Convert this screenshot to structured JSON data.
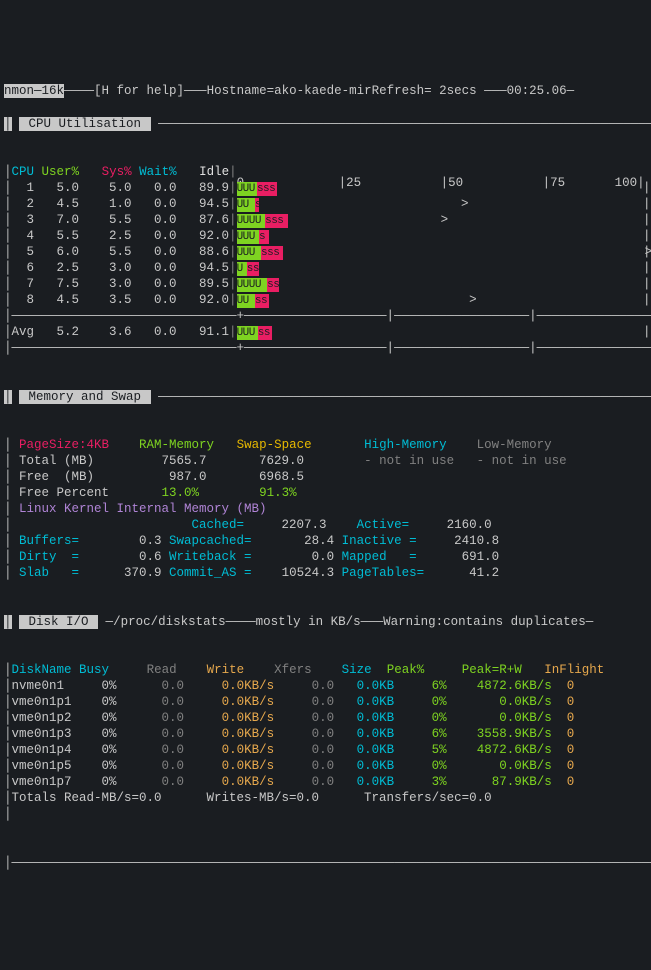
{
  "header": {
    "app": "nmon—16k",
    "help": "[H for help]",
    "hostname_label": "Hostname=",
    "hostname": "ako-kaede-mir",
    "refresh_label": "Refresh= ",
    "refresh": "2secs",
    "time": "00:25.06"
  },
  "cpu_section": {
    "title": " CPU Utilisation ",
    "headers": {
      "cpu": "CPU",
      "user": "User%",
      "sys": "Sys%",
      "wait": "Wait%",
      "idle": "Idle"
    },
    "ticks": [
      "0",
      "25",
      "50",
      "75",
      "100"
    ],
    "rows": [
      {
        "cpu": "1",
        "user": "5.0",
        "sys": "5.0",
        "wait": "0.0",
        "idle": "89.9",
        "u": 5,
        "s": 5,
        "caret": null
      },
      {
        "cpu": "2",
        "user": "4.5",
        "sys": "1.0",
        "wait": "0.0",
        "idle": "94.5",
        "u": 4.5,
        "s": 1,
        "caret": 55
      },
      {
        "cpu": "3",
        "user": "7.0",
        "sys": "5.5",
        "wait": "0.0",
        "idle": "87.6",
        "u": 7,
        "s": 5.5,
        "caret": 50
      },
      {
        "cpu": "4",
        "user": "5.5",
        "sys": "2.5",
        "wait": "0.0",
        "idle": "92.0",
        "u": 5.5,
        "s": 2.5,
        "caret": null
      },
      {
        "cpu": "5",
        "user": "6.0",
        "sys": "5.5",
        "wait": "0.0",
        "idle": "88.6",
        "u": 6,
        "s": 5.5,
        "caret": 100
      },
      {
        "cpu": "6",
        "user": "2.5",
        "sys": "3.0",
        "wait": "0.0",
        "idle": "94.5",
        "u": 2.5,
        "s": 3,
        "caret": null
      },
      {
        "cpu": "7",
        "user": "7.5",
        "sys": "3.0",
        "wait": "0.0",
        "idle": "89.5",
        "u": 7.5,
        "s": 3,
        "caret": null
      },
      {
        "cpu": "8",
        "user": "4.5",
        "sys": "3.5",
        "wait": "0.0",
        "idle": "92.0",
        "u": 4.5,
        "s": 3.5,
        "caret": 57
      }
    ],
    "avg": {
      "label": "Avg",
      "user": "5.2",
      "sys": "3.6",
      "wait": "0.0",
      "idle": "91.1",
      "u": 5.2,
      "s": 3.6
    }
  },
  "mem_section": {
    "title": " Memory and Swap ",
    "pagesize": "PageSize:4KB",
    "col_ram": "RAM-Memory",
    "col_swap": "Swap-Space",
    "col_high": "High-Memory",
    "col_low": "Low-Memory",
    "total_label": "Total (MB)",
    "total_ram": "7565.7",
    "total_swap": "7629.0",
    "not_in_use": "- not in use",
    "free_label": "Free  (MB)",
    "free_ram": "987.0",
    "free_swap": "6968.5",
    "freep_label": "Free Percent",
    "freep_ram": "13.0%",
    "freep_swap": "91.3%",
    "kernel_label": "Linux Kernel Internal Memory (MB)",
    "cached_l": "Cached=",
    "cached_v": "2207.3",
    "active_l": "Active=",
    "active_v": "2160.0",
    "buffers_l": "Buffers=",
    "buffers_v": "0.3",
    "swapcached_l": "Swapcached=",
    "swapcached_v": "28.4",
    "inactive_l": "Inactive =",
    "inactive_v": "2410.8",
    "dirty_l": "Dirty  =",
    "dirty_v": "0.6",
    "writeback_l": "Writeback =",
    "writeback_v": "0.0",
    "mapped_l": "Mapped   =",
    "mapped_v": "691.0",
    "slab_l": "Slab   =",
    "slab_v": "370.9",
    "commit_l": "Commit_AS =",
    "commit_v": "10524.3",
    "pagetables_l": "PageTables=",
    "pagetables_v": "41.2"
  },
  "disk_section": {
    "title": " Disk I/O ",
    "subtitle": "/proc/diskstats",
    "mostly": "mostly in KB/s",
    "warning": "Warning:contains duplicates",
    "headers": {
      "name": "DiskName",
      "busy": "Busy",
      "read": "Read",
      "write": "Write",
      "xfers": "Xfers",
      "size": "Size",
      "peak": "Peak%",
      "peakrw": "Peak=R+W",
      "inflight": "InFlight"
    },
    "rows": [
      {
        "name": "nvme0n1",
        "busy": "0%",
        "read": "0.0",
        "write": "0.0KB/s",
        "xfers": "0.0",
        "size": "0.0KB",
        "peak": "6%",
        "peakrw": "4872.6KB/s",
        "inflight": "0"
      },
      {
        "name": "vme0n1p1",
        "busy": "0%",
        "read": "0.0",
        "write": "0.0KB/s",
        "xfers": "0.0",
        "size": "0.0KB",
        "peak": "0%",
        "peakrw": "0.0KB/s",
        "inflight": "0"
      },
      {
        "name": "vme0n1p2",
        "busy": "0%",
        "read": "0.0",
        "write": "0.0KB/s",
        "xfers": "0.0",
        "size": "0.0KB",
        "peak": "0%",
        "peakrw": "0.0KB/s",
        "inflight": "0"
      },
      {
        "name": "vme0n1p3",
        "busy": "0%",
        "read": "0.0",
        "write": "0.0KB/s",
        "xfers": "0.0",
        "size": "0.0KB",
        "peak": "6%",
        "peakrw": "3558.9KB/s",
        "inflight": "0"
      },
      {
        "name": "vme0n1p4",
        "busy": "0%",
        "read": "0.0",
        "write": "0.0KB/s",
        "xfers": "0.0",
        "size": "0.0KB",
        "peak": "5%",
        "peakrw": "4872.6KB/s",
        "inflight": "0"
      },
      {
        "name": "vme0n1p5",
        "busy": "0%",
        "read": "0.0",
        "write": "0.0KB/s",
        "xfers": "0.0",
        "size": "0.0KB",
        "peak": "0%",
        "peakrw": "0.0KB/s",
        "inflight": "0"
      },
      {
        "name": "vme0n1p7",
        "busy": "0%",
        "read": "0.0",
        "write": "0.0KB/s",
        "xfers": "0.0",
        "size": "0.0KB",
        "peak": "3%",
        "peakrw": "87.9KB/s",
        "inflight": "0"
      }
    ],
    "totals": {
      "label": "Totals",
      "read": "Read-MB/s=0.0",
      "write": "Writes-MB/s=0.0",
      "xfers": "Transfers/sec=0.0"
    }
  }
}
